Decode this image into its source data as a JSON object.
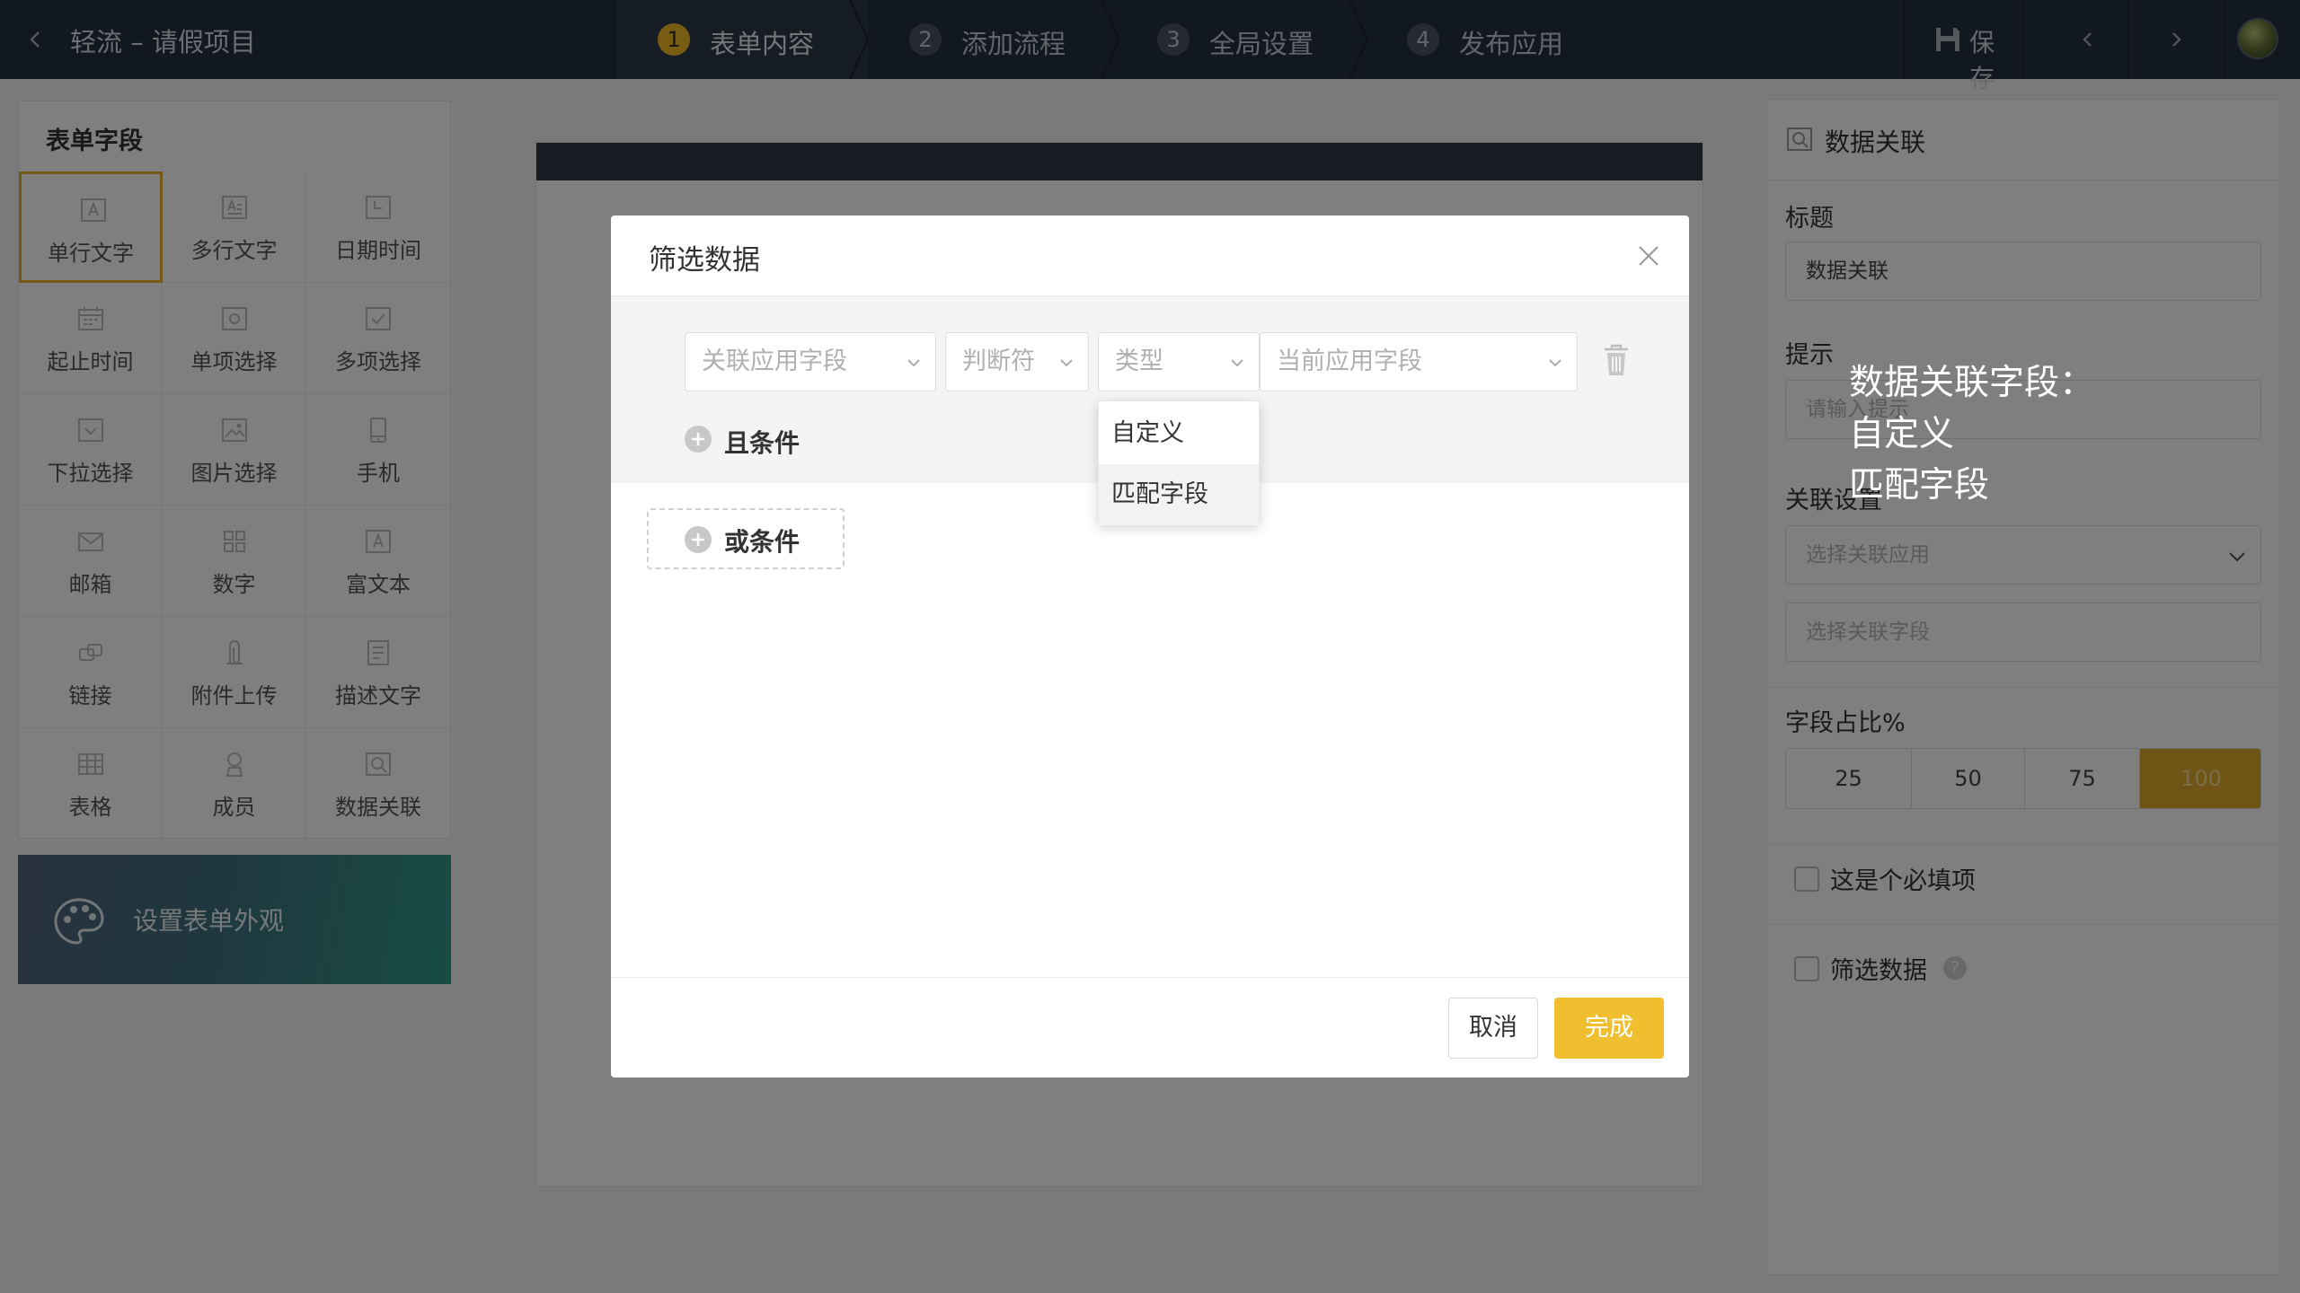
{
  "topbar": {
    "app_title": "轻流 – 请假项目",
    "steps": [
      {
        "num": "1",
        "label": "表单内容"
      },
      {
        "num": "2",
        "label": "添加流程"
      },
      {
        "num": "3",
        "label": "全局设置"
      },
      {
        "num": "4",
        "label": "发布应用"
      }
    ],
    "save_label": "保存"
  },
  "left_panel": {
    "heading": "表单字段",
    "fields": [
      {
        "label": "单行文字",
        "icon": "single-line-text-icon"
      },
      {
        "label": "多行文字",
        "icon": "multi-line-text-icon"
      },
      {
        "label": "日期时间",
        "icon": "datetime-icon"
      },
      {
        "label": "起止时间",
        "icon": "date-range-icon"
      },
      {
        "label": "单项选择",
        "icon": "radio-icon"
      },
      {
        "label": "多项选择",
        "icon": "checkbox-icon"
      },
      {
        "label": "下拉选择",
        "icon": "dropdown-icon"
      },
      {
        "label": "图片选择",
        "icon": "image-select-icon"
      },
      {
        "label": "手机",
        "icon": "phone-icon"
      },
      {
        "label": "邮箱",
        "icon": "mail-icon"
      },
      {
        "label": "数字",
        "icon": "number-icon"
      },
      {
        "label": "富文本",
        "icon": "rich-text-icon"
      },
      {
        "label": "链接",
        "icon": "link-icon"
      },
      {
        "label": "附件上传",
        "icon": "attachment-icon"
      },
      {
        "label": "描述文字",
        "icon": "description-icon"
      },
      {
        "label": "表格",
        "icon": "table-icon"
      },
      {
        "label": "成员",
        "icon": "member-icon"
      },
      {
        "label": "数据关联",
        "icon": "data-link-icon"
      }
    ],
    "appearance_label": "设置表单外观"
  },
  "right_panel": {
    "title": "数据关联",
    "label_title": "标题",
    "title_value": "数据关联",
    "label_hint": "提示",
    "hint_placeholder": "请输入提示",
    "label_link": "关联设置",
    "select_app_placeholder": "选择关联应用",
    "select_field_placeholder": "选择关联字段",
    "label_ratio": "字段占比%",
    "ratios": [
      "25",
      "50",
      "75",
      "100"
    ],
    "ratio_selected": "100",
    "required_label": "这是个必填项",
    "filter_label": "筛选数据",
    "help_glyph": "?"
  },
  "modal": {
    "title": "筛选数据",
    "selects": {
      "linked_field": "关联应用字段",
      "operator": "判断符",
      "type": "类型",
      "current_field": "当前应用字段"
    },
    "type_options": [
      "自定义",
      "匹配字段"
    ],
    "type_option_highlighted": "匹配字段",
    "and_label": "且条件",
    "or_label": "或条件",
    "cancel_label": "取消",
    "done_label": "完成"
  },
  "annotation": {
    "lines": [
      "数据关联字段：",
      "自定义",
      "匹配字段"
    ]
  },
  "colors": {
    "topbar_bg": "#253040",
    "accent": "#f0bf30",
    "step_active_badge": "#f0b925"
  }
}
